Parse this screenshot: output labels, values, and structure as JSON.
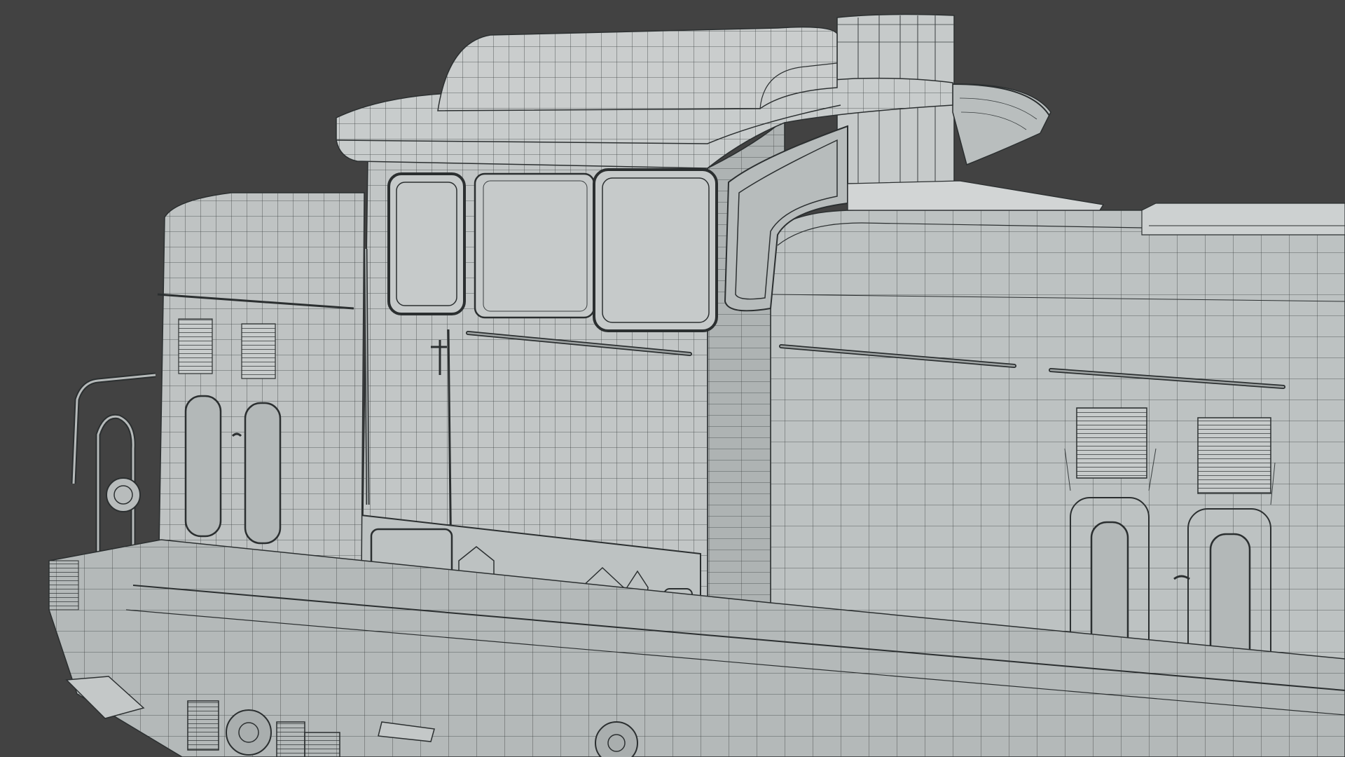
{
  "viewport": {
    "background_color": "#424242",
    "subject": "wireframe-locomotive-model",
    "colors": {
      "surface": "#bcc1c1",
      "surface_light": "#c9cdcd",
      "surface_shade": "#a7acac",
      "wire": "#2b2f30",
      "wire_light": "#5a6061"
    }
  }
}
